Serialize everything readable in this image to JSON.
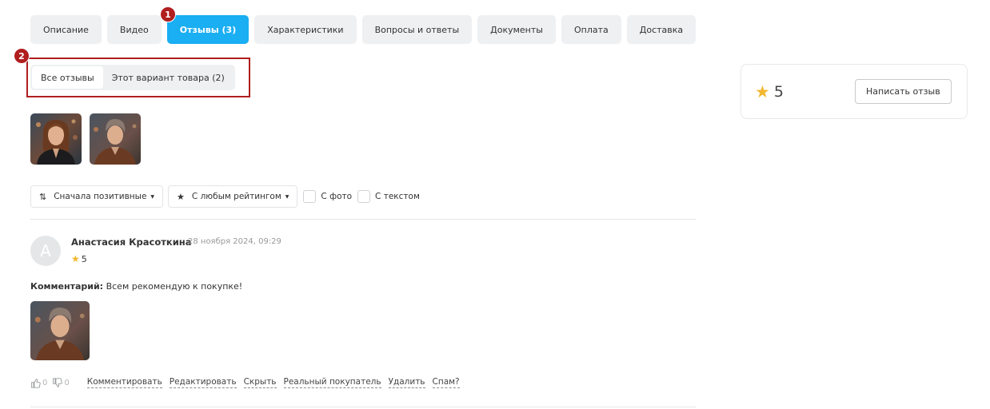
{
  "tabs": [
    {
      "label": "Описание",
      "active": false
    },
    {
      "label": "Видео",
      "active": false
    },
    {
      "label": "Отзывы (3)",
      "active": true
    },
    {
      "label": "Характеристики",
      "active": false
    },
    {
      "label": "Вопросы и ответы",
      "active": false
    },
    {
      "label": "Документы",
      "active": false
    },
    {
      "label": "Оплата",
      "active": false
    },
    {
      "label": "Доставка",
      "active": false
    }
  ],
  "annotations": {
    "badge_1": "1",
    "badge_2": "2"
  },
  "subtabs": [
    {
      "label": "Все отзывы",
      "active": true
    },
    {
      "label": "Этот вариант товара (2)",
      "active": false
    }
  ],
  "filters": {
    "sort_label": "Сначала позитивные",
    "rating_label": "С любым рейтингом",
    "with_photo_label": "С фото",
    "with_text_label": "С текстом"
  },
  "review": {
    "avatar_letter": "А",
    "author": "Анастасия Красоткина",
    "date": "28 ноября 2024, 09:29",
    "rating": "5",
    "comment_label": "Комментарий:",
    "comment_text": "Всем рекомендую к покупке!",
    "likes": "0",
    "dislikes": "0",
    "actions": [
      "Комментировать",
      "Редактировать",
      "Скрыть",
      "Реальный покупатель",
      "Удалить",
      "Спам?"
    ]
  },
  "sidebar": {
    "average_rating": "5",
    "write_review_label": "Написать отзыв"
  },
  "colors": {
    "accent": "#1aaef2",
    "annotation": "#b01e1e",
    "star": "#f2b731",
    "tab_bg": "#eef0f2"
  }
}
